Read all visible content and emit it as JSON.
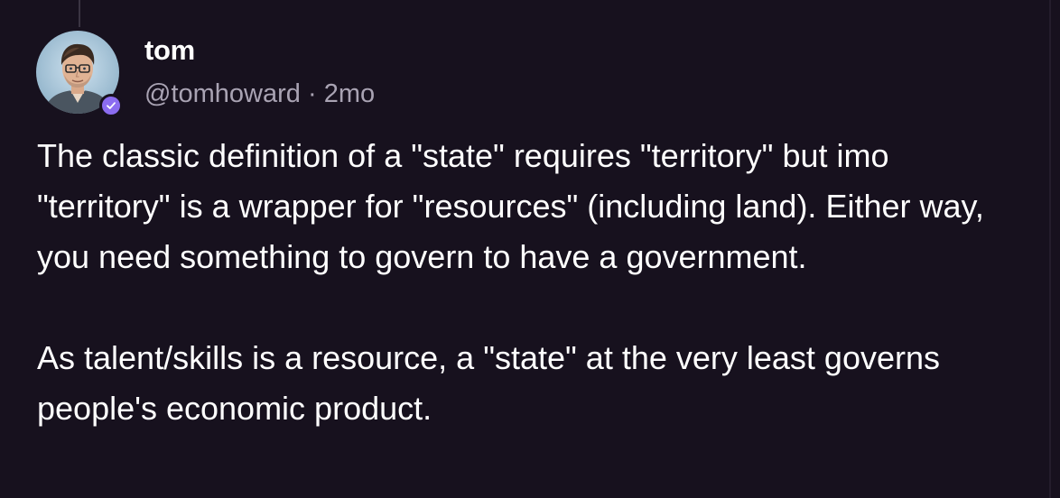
{
  "post": {
    "author": {
      "display_name": "tom",
      "handle": "@tomhoward",
      "verified": true,
      "avatar_icon": "user-avatar-icon"
    },
    "separator": " · ",
    "timestamp": "2mo",
    "paragraphs": [
      "The classic definition of a \"state\" requires \"territory\" but imo \"territory\" is a wrapper for \"resources\" (including land). Either way, you need something to govern to have a government.",
      "As talent/skills is a resource, a \"state\" at the very least governs people's economic product."
    ]
  },
  "colors": {
    "background": "#17111e",
    "text": "#ffffff",
    "muted": "#a9a3b3",
    "verified_badge": "#8b6cf0"
  }
}
